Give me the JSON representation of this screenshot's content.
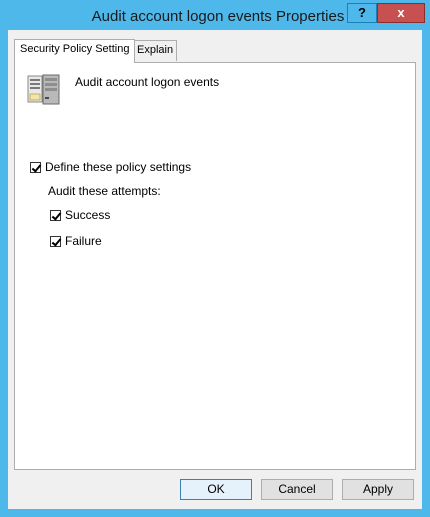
{
  "window": {
    "title": "Audit account logon events Properties",
    "help_label": "?",
    "close_label": "x"
  },
  "tabs": [
    {
      "label": "Security Policy Setting",
      "active": true
    },
    {
      "label": "Explain",
      "active": false
    }
  ],
  "policy": {
    "name": "Audit account logon events",
    "icon": "server-document-icon"
  },
  "settings": {
    "define_label": "Define these policy settings",
    "define_checked": true,
    "attempts_label": "Audit these attempts:",
    "success_label": "Success",
    "success_checked": true,
    "failure_label": "Failure",
    "failure_checked": true
  },
  "buttons": {
    "ok": "OK",
    "cancel": "Cancel",
    "apply": "Apply"
  },
  "colors": {
    "titlebar": "#4fb8ea",
    "close": "#c75050",
    "client": "#f0f0f0"
  }
}
